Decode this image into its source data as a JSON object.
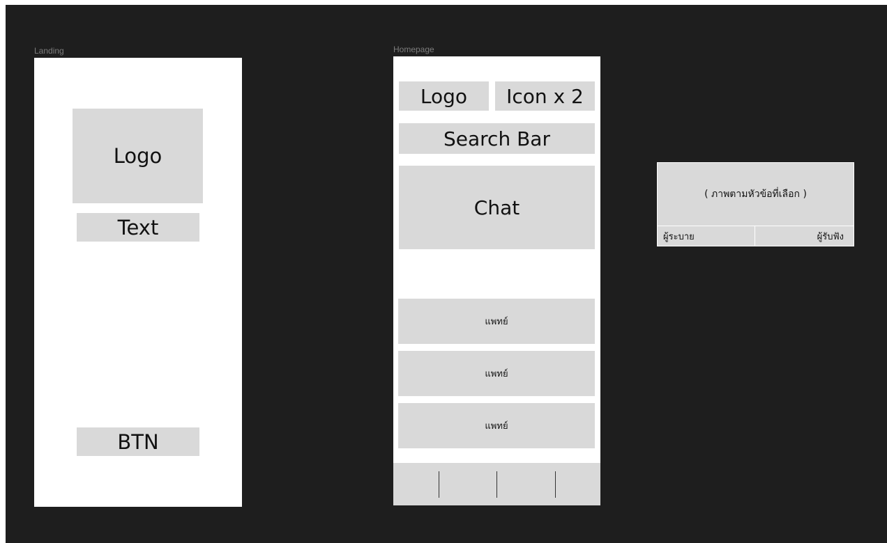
{
  "landing": {
    "frame_label": "Landing",
    "logo": "Logo",
    "text": "Text",
    "button": "BTN"
  },
  "homepage": {
    "frame_label": "Homepage",
    "logo": "Logo",
    "icons": "Icon x 2",
    "search_bar": "Search Bar",
    "chat": "Chat",
    "doctor_cards": [
      "แพทย์",
      "แพทย์",
      "แพทย์"
    ],
    "bottom_nav_sections": 4
  },
  "topic_card": {
    "caption": "( ภาพตามหัวข้อที่เลือก )",
    "tabs": [
      "ผู้ระบาย",
      "ผู้รับฟัง"
    ]
  },
  "colors": {
    "canvas_bg": "#1e1e1e",
    "frame_bg": "#ffffff",
    "placeholder": "#d9d9d9",
    "label_text": "#7c7c7c"
  }
}
